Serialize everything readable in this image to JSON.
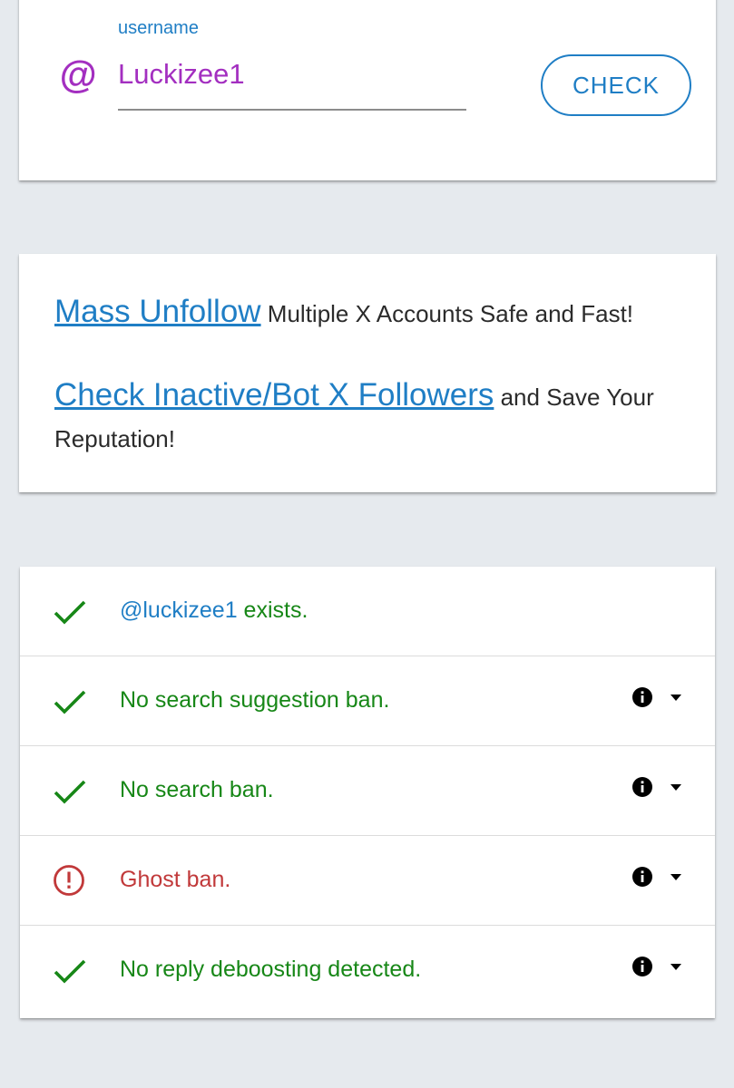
{
  "search": {
    "label": "username",
    "at_symbol": "@",
    "value": "Luckizee1",
    "button_label": "CHECK"
  },
  "promo": {
    "line1_link": "Mass Unfollow",
    "line1_text": " Multiple X Accounts Safe and Fast!",
    "line2_link": "Check Inactive/Bot X Followers",
    "line2_text": " and Save Your Reputation!"
  },
  "results": {
    "exists_handle": "@luckizee1",
    "exists_text": " exists.",
    "items": [
      {
        "label": "No search suggestion ban.",
        "status": "ok"
      },
      {
        "label": "No search ban.",
        "status": "ok"
      },
      {
        "label": "Ghost ban.",
        "status": "error"
      },
      {
        "label": "No reply deboosting detected.",
        "status": "ok"
      }
    ]
  },
  "colors": {
    "accent": "#1f7ec5",
    "username": "#a32fc0",
    "ok": "#178717",
    "error": "#c1393a",
    "background": "#e6eaee"
  }
}
